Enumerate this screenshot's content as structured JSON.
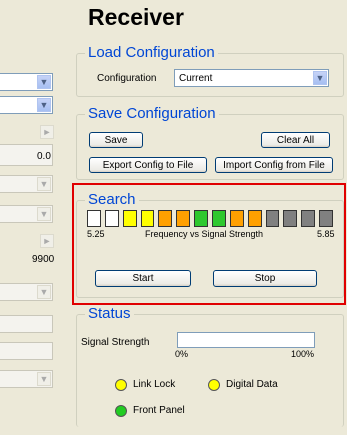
{
  "title": "Receiver",
  "left_values": [
    "0.0",
    "9900"
  ],
  "load": {
    "label": "Load Configuration",
    "config_label": "Configuration",
    "config_value": "Current"
  },
  "save": {
    "label": "Save Configuration",
    "save": "Save",
    "clear": "Clear All",
    "export": "Export Config to File",
    "import": "Import Config from File"
  },
  "search": {
    "label": "Search",
    "freq_min": "5.25",
    "freq_max": "5.85",
    "caption": "Frequency vs Signal Strength",
    "segment_colors": [
      "#ffffff",
      "#ffffff",
      "#ffff00",
      "#ffff00",
      "#ffa000",
      "#ffa000",
      "#2ec82e",
      "#2ec82e",
      "#ffa000",
      "#ffa000",
      "#808080",
      "#808080",
      "#808080",
      "#808080"
    ],
    "start": "Start",
    "stop": "Stop"
  },
  "status": {
    "label": "Status",
    "signal_label": "Signal Strength",
    "signal_level": 0,
    "pct_min": "0%",
    "pct_max": "100%",
    "link_lock": "Link Lock",
    "digital_data": "Digital Data",
    "front_panel": "Front Panel",
    "colors": {
      "link_lock": "#ffff00",
      "digital_data": "#ffff00",
      "front_panel": "#22cc22"
    }
  }
}
